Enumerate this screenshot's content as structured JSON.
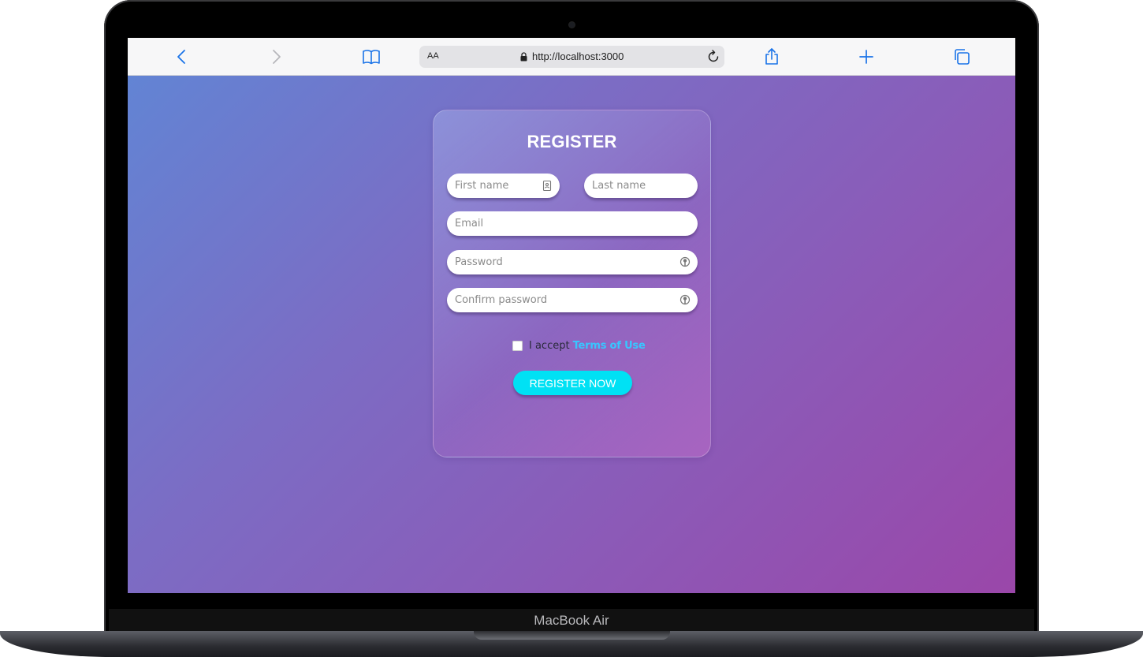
{
  "device": {
    "label": "MacBook Air"
  },
  "browser": {
    "text_size_label": "AA",
    "url": "http://localhost:3000",
    "icons": [
      "back-icon",
      "forward-icon",
      "bookmarks-icon",
      "lock-icon",
      "reload-icon",
      "share-icon",
      "new-tab-icon",
      "tabs-icon"
    ]
  },
  "form": {
    "title": "REGISTER",
    "first_name_placeholder": "First name",
    "last_name_placeholder": "Last name",
    "email_placeholder": "Email",
    "password_placeholder": "Password",
    "confirm_password_placeholder": "Confirm password",
    "terms_prefix": "I accept",
    "terms_link": "Terms of Use",
    "submit_label": "REGISTER NOW"
  },
  "colors": {
    "accent": "#00e1f4",
    "link": "#38c6ff",
    "bg_start": "#6284d4",
    "bg_end": "#9a47a9",
    "browser_tint": "#1a73e8"
  }
}
